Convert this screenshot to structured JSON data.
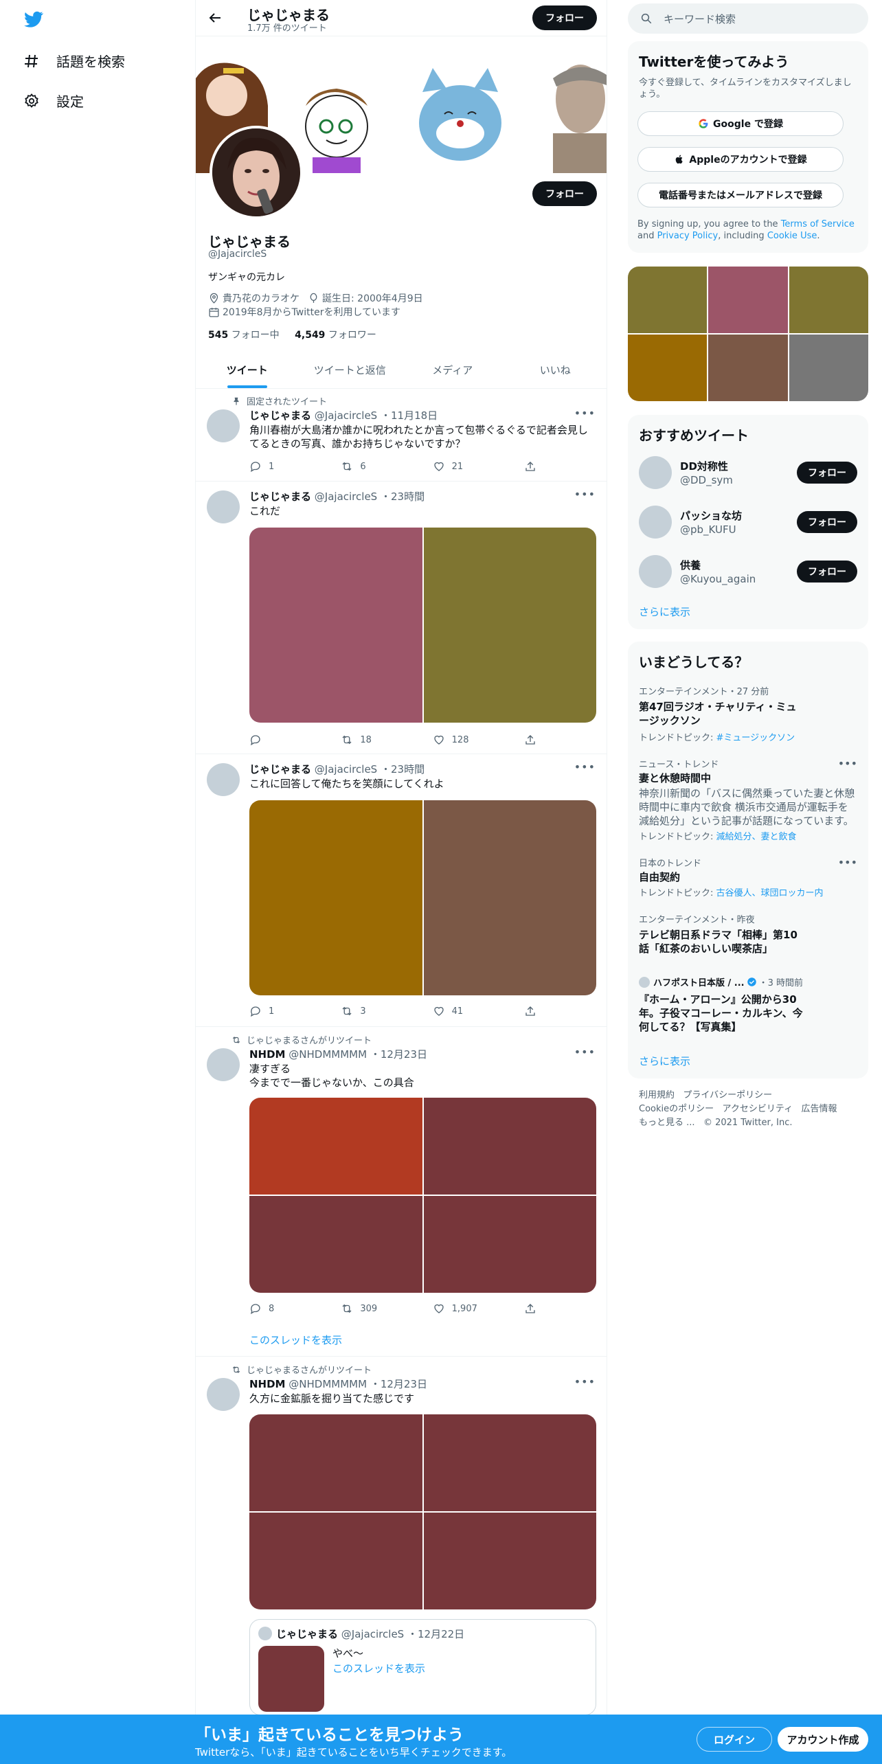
{
  "nav": {
    "explore_label": "話題を検索",
    "settings_label": "設定"
  },
  "header": {
    "title": "じゃじゃまる",
    "tweet_count": "1.7万 件のツイート",
    "follow_label": "フォロー"
  },
  "profile": {
    "name": "じゃじゃまる",
    "handle": "@JajacircleS",
    "bio": "ザンギャの元カレ",
    "location": "貴乃花のカラオケ",
    "birthday": "誕生日: 2000年4月9日",
    "joined": "2019年8月からTwitterを利用しています",
    "following_count": "545",
    "following_label": "フォロー中",
    "followers_count": "4,549",
    "followers_label": "フォロワー",
    "follow_label": "フォロー"
  },
  "tabs": [
    "ツイート",
    "ツイートと返信",
    "メディア",
    "いいね"
  ],
  "tweets": [
    {
      "context": "固定されたツイート",
      "name": "じゃじゃまる",
      "handle": "@JajacircleS",
      "time": "・11月18日",
      "text": "角川春樹が大島渚か誰かに呪われたとか言って包帯ぐるぐるで記者会見してるときの写真、誰かお持ちじゃないですか？",
      "replies": "1",
      "retweets": "6",
      "likes": "21"
    },
    {
      "name": "じゃじゃまる",
      "handle": "@JajacircleS",
      "time": "・23時間",
      "text": "これだ",
      "media_colors": [
        "#9c5568",
        "#7f7531"
      ],
      "replies": "",
      "retweets": "18",
      "likes": "128"
    },
    {
      "name": "じゃじゃまる",
      "handle": "@JajacircleS",
      "time": "・23時間",
      "text": "これに回答して俺たちを笑顔にしてくれよ",
      "media_colors": [
        "#9a6a03",
        "#7b5846"
      ],
      "replies": "1",
      "retweets": "3",
      "likes": "41"
    },
    {
      "context": "じゃじゃまるさんがリツイート",
      "name": "NHDM",
      "handle": "@NHDMMMMM",
      "time": "・12月23日",
      "text": "凄すぎる\n今までで一番じゃないか、この具合",
      "media_colors": [
        "#b23a22",
        "#77363a",
        "#77363a",
        "#77363a"
      ],
      "replies": "8",
      "retweets": "309",
      "likes": "1,907",
      "show_thread": "このスレッドを表示"
    },
    {
      "context": "じゃじゃまるさんがリツイート",
      "name": "NHDM",
      "handle": "@NHDMMMMM",
      "time": "・12月23日",
      "text": "久方に金鉱脈を掘り当てた感じです",
      "media_colors": [
        "#77363a",
        "#77363a",
        "#77363a",
        "#77363a"
      ],
      "quote": {
        "name": "じゃじゃまる",
        "handle": "@JajacircleS",
        "time": "・12月22日",
        "text": "やべ〜",
        "show_thread": "このスレッドを表示",
        "thumb_color": "#77363a"
      }
    }
  ],
  "sidebar": {
    "search_placeholder": "キーワード検索",
    "signup": {
      "title": "Twitterを使ってみよう",
      "subtitle": "今すぐ登録して、タイムラインをカスタマイズしましょう。",
      "google": "Google で登録",
      "apple": "Appleのアカウントで登録",
      "phone": "電話番号またはメールアドレスで登録",
      "terms_pre": "By signing up, you agree to the ",
      "terms_link": "Terms of Service",
      "terms_and": " and ",
      "privacy_link": "Privacy Policy",
      "terms_mid": ", including ",
      "cookie_link": "Cookie Use",
      "terms_end": "."
    },
    "media_grid_colors": [
      "#7f7531",
      "#9c5568",
      "#7f7531",
      "#9a6a03",
      "#7b5846",
      "#777777"
    ],
    "recommend": {
      "title": "おすすめツイート",
      "accounts": [
        {
          "name": "DD対称性",
          "handle": "@DD_sym"
        },
        {
          "name": "パッショな坊",
          "handle": "@pb_KUFU"
        },
        {
          "name": "供養",
          "handle": "@Kuyou_again"
        }
      ],
      "follow_label": "フォロー",
      "more": "さらに表示"
    },
    "trends": {
      "title": "いまどうしてる？",
      "items": [
        {
          "category": "エンターテインメント・27 分前",
          "title": "第47回ラジオ・チャリティ・ミュージックソン",
          "topic_label": "トレンドトピック: ",
          "topic": "#ミュージックソン"
        },
        {
          "category": "ニュース・トレンド",
          "title": "妻と休憩時間中",
          "desc": "神奈川新聞の「バスに偶然乗っていた妻と休憩時間中に車内で飲食 横浜市交通局が運転手を減給処分」という記事が話題になっています。",
          "topic_label": "トレンドトピック: ",
          "topic": "減給処分、妻と飲食"
        },
        {
          "category": "日本のトレンド",
          "title": "自由契約",
          "topic_label": "トレンドトピック: ",
          "topic": "古谷優人、球団ロッカー内"
        },
        {
          "category": "エンターテインメント・昨夜",
          "title": "テレビ朝日系ドラマ「相棒」第10話「紅茶のおいしい喫茶店」"
        },
        {
          "source": "ハフポスト日本版 / ...",
          "time": "・3 時間前",
          "title": "『ホーム・アローン』公開から30年。子役マコーレー・カルキン、今何してる？【写真集】"
        }
      ],
      "more": "さらに表示"
    },
    "footer": {
      "links": [
        "利用規約",
        "プライバシーポリシー",
        "Cookieのポリシー",
        "アクセシビリティ",
        "広告情報",
        "もっと見る ..."
      ],
      "copyright": "© 2021 Twitter, Inc."
    }
  },
  "bottom_bar": {
    "title": "「いま」起きていることを見つけよう",
    "subtitle": "Twitterなら、「いま」起きていることをいち早くチェックできます。",
    "login": "ログイン",
    "signup": "アカウント作成"
  },
  "colors": {
    "accent": "#1d9bf0",
    "dark_button": "#0f1419",
    "bottom_bar": "#1d9bf0"
  }
}
